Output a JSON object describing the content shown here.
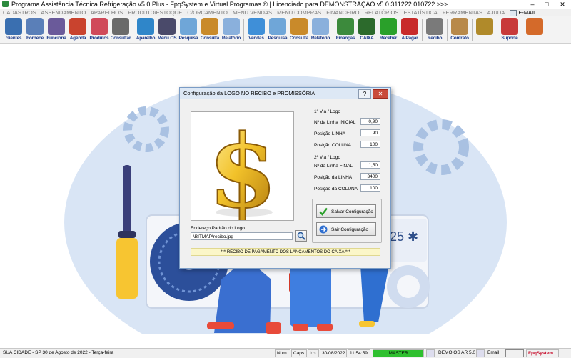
{
  "window": {
    "title": "Programa Assistência Técnica Refrigeração v5.0 Plus - FpqSystem e Virtual Programas ® | Licenciado para  DEMONSTRAÇÃO v5.0 311222 010722 >>>",
    "minimize": "–",
    "maximize": "□",
    "close": "✕"
  },
  "menu": [
    "CADASTROS",
    "ASSENDAMENTO",
    "APARELHOS",
    "PRODUTO/ESTOQUE",
    "O/ORÇAMENTO",
    "MENU VENDAS",
    "MENU COMPRAS",
    "FINANCEIRO",
    "RELATÓRIOS",
    "ESTATÍSTICA",
    "FERRAMENTAS",
    "AJUDA"
  ],
  "menu_email": "E-MAIL",
  "toolbar": [
    {
      "label": "clientes",
      "icon": "clients-icon",
      "color": "#3a6fb0"
    },
    {
      "label": "Fornece",
      "icon": "supplier-icon",
      "color": "#5a7fb8"
    },
    {
      "label": "Funciona",
      "icon": "employee-icon",
      "color": "#6a5a9a"
    },
    {
      "label": "Agenda",
      "icon": "calendar-icon",
      "color": "#c9432e"
    },
    {
      "label": "Produtos",
      "icon": "products-icon",
      "color": "#d04a5a"
    },
    {
      "label": "Consultar",
      "icon": "search-products-icon",
      "color": "#6a6a6a"
    },
    {
      "label": "Aparelho",
      "icon": "device-icon",
      "color": "#2f86c9"
    },
    {
      "label": "Menu OS",
      "icon": "tools-icon",
      "color": "#4a4a6a"
    },
    {
      "label": "Pesquisa",
      "icon": "search-icon",
      "color": "#6fa6d8"
    },
    {
      "label": "Consulta",
      "icon": "folder-icon",
      "color": "#c98a2a"
    },
    {
      "label": "Relatório",
      "icon": "report-icon",
      "color": "#8ab0dc"
    },
    {
      "label": "Vendas",
      "icon": "sales-icon",
      "color": "#3f8fd8"
    },
    {
      "label": "Pesquisa",
      "icon": "search-icon",
      "color": "#6fa6d8"
    },
    {
      "label": "Consulta",
      "icon": "folder-icon",
      "color": "#c98a2a"
    },
    {
      "label": "Relatório",
      "icon": "report-icon",
      "color": "#8ab0dc"
    },
    {
      "label": "Finanças",
      "icon": "finance-icon",
      "color": "#3c8a3c"
    },
    {
      "label": "CAIXA",
      "icon": "cashier-icon",
      "color": "#2c6a2c"
    },
    {
      "label": "Receber",
      "icon": "receive-icon",
      "color": "#2aa02a"
    },
    {
      "label": "A Pagar",
      "icon": "pay-icon",
      "color": "#c82a2a"
    },
    {
      "label": "Recibo",
      "icon": "receipt-icon",
      "color": "#7a7a7a"
    },
    {
      "label": "Contrato",
      "icon": "contract-icon",
      "color": "#b8894a"
    },
    {
      "label": "",
      "icon": "coins-icon",
      "color": "#b08a2a"
    },
    {
      "label": "Suporte",
      "icon": "support-icon",
      "color": "#c83a3a"
    },
    {
      "label": "",
      "icon": "exit-icon",
      "color": "#d46a2a"
    }
  ],
  "dialog": {
    "title": "Configuração da LOGO NO RECIBO e PROMISSÓRIA",
    "help": "?",
    "close": "✕",
    "via1_header": "1ª Via / Logo",
    "via1": [
      {
        "label": "Nº da Linha INICIAL",
        "value": "0,90"
      },
      {
        "label": "Posição LINHA",
        "value": "90"
      },
      {
        "label": "Posição COLUNA",
        "value": "100"
      }
    ],
    "via2_header": "2ª Via / Logo",
    "via2": [
      {
        "label": "Nº da Linha FINAL",
        "value": "1,50"
      },
      {
        "label": "Posição da LINHA",
        "value": "3400"
      },
      {
        "label": "Posição da COLUNA",
        "value": "100"
      }
    ],
    "path_label": "Endereço Padrão do Logo",
    "path_value": "\\BITMAP\\recibo.jpg",
    "save_label": "Salvar Configuração",
    "exit_label": "Sair Configuração",
    "footer_note": "*** RECIBO DE PAGAMENTO DOS LANÇAMENTOS DO CAIXA ***"
  },
  "status": {
    "city": "SUA CIDADE - SP 30 de Agosto de 2022 - Terça-feira",
    "num": "Num",
    "caps": "Caps",
    "ins": "Ins",
    "date": "30/08/2022",
    "time": "11:54:59",
    "master": "MASTER",
    "demo": "DEMO OS AR 5.0",
    "email": "Email",
    "brand": "FpqSystem"
  },
  "colors": {
    "accent_blue": "#3d6fb8",
    "master_green": "#2fc02f",
    "brand_red": "#c8102e"
  }
}
